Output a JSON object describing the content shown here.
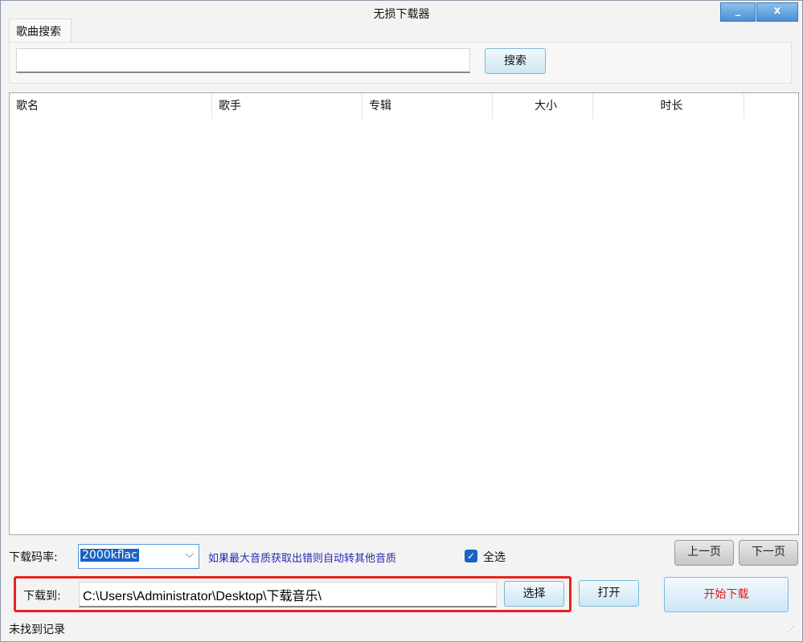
{
  "window": {
    "title": "无损下载器",
    "minimize": "_",
    "close": "x"
  },
  "tabs": [
    {
      "label": "歌曲搜索"
    }
  ],
  "search": {
    "value": "",
    "button": "搜索"
  },
  "table": {
    "columns": [
      "歌名",
      "歌手",
      "专辑",
      "大小",
      "时长"
    ],
    "rows": []
  },
  "bitrate": {
    "label": "下载码率:",
    "value": "2000kflac",
    "hint": "如果最大音质获取出错则自动转其他音质"
  },
  "select_all": {
    "label": "全选",
    "checked": true
  },
  "pager": {
    "prev": "上一页",
    "next": "下一页"
  },
  "download": {
    "label": "下载到:",
    "path": "C:\\Users\\Administrator\\Desktop\\下载音乐\\",
    "choose": "选择",
    "open": "打开",
    "start": "开始下载"
  },
  "status": "未找到记录",
  "colors": {
    "highlight_border": "#e8231e",
    "hint": "#2a2ab0",
    "start_text": "#e01818",
    "accent": "#1a62c4"
  }
}
